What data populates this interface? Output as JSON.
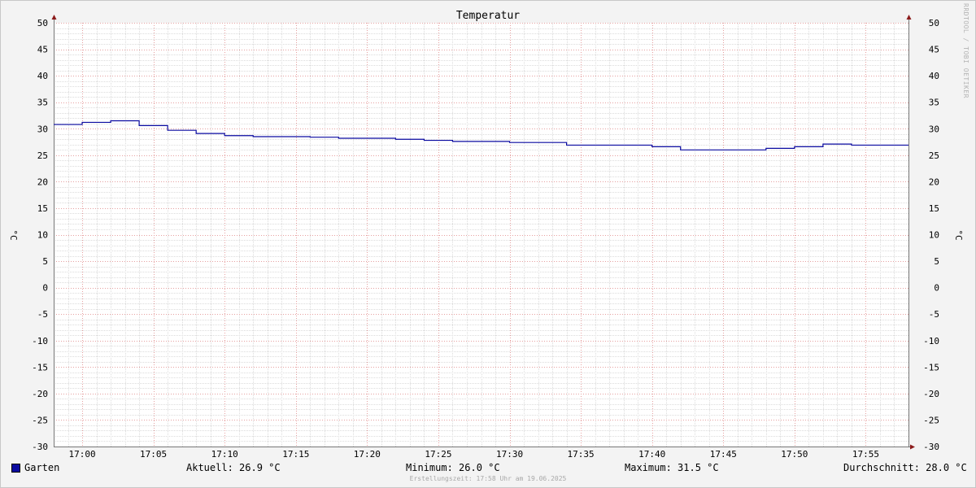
{
  "chart_data": {
    "type": "line",
    "title": "Temperatur",
    "ylabel": "°C",
    "ylabel_right": "°C",
    "ylim": [
      -30,
      50
    ],
    "yticks": [
      50,
      45,
      40,
      35,
      30,
      25,
      20,
      15,
      10,
      5,
      0,
      -5,
      -10,
      -15,
      -20,
      -25,
      -30
    ],
    "xlim": [
      "16:58",
      "17:58"
    ],
    "xticks": [
      "17:00",
      "17:05",
      "17:10",
      "17:15",
      "17:20",
      "17:25",
      "17:30",
      "17:35",
      "17:40",
      "17:45",
      "17:50",
      "17:55"
    ],
    "grid": true,
    "step": true,
    "series": [
      {
        "name": "Garten",
        "color": "#0a0aa0",
        "points": [
          [
            "16:58",
            30.8
          ],
          [
            "17:00",
            31.2
          ],
          [
            "17:02",
            31.5
          ],
          [
            "17:04",
            30.6
          ],
          [
            "17:06",
            29.7
          ],
          [
            "17:08",
            29.1
          ],
          [
            "17:10",
            28.7
          ],
          [
            "17:12",
            28.5
          ],
          [
            "17:16",
            28.4
          ],
          [
            "17:18",
            28.2
          ],
          [
            "17:22",
            28.0
          ],
          [
            "17:24",
            27.8
          ],
          [
            "17:26",
            27.6
          ],
          [
            "17:30",
            27.4
          ],
          [
            "17:34",
            26.9
          ],
          [
            "17:40",
            26.6
          ],
          [
            "17:42",
            26.0
          ],
          [
            "17:48",
            26.3
          ],
          [
            "17:50",
            26.6
          ],
          [
            "17:52",
            27.1
          ],
          [
            "17:54",
            26.9
          ],
          [
            "17:58",
            26.9
          ]
        ]
      }
    ]
  },
  "legend": {
    "series_name": "Garten"
  },
  "stats": {
    "current": "Aktuell: 26.9 °C",
    "minimum": "Minimum: 26.0 °C",
    "maximum": "Maximum: 31.5 °C",
    "average": "Durchschnitt: 28.0 °C"
  },
  "watermark": "RRDTOOL / TOBI OETIKER",
  "footer": "Erstellungszeit: 17:58 Uhr am 19.06.2025"
}
